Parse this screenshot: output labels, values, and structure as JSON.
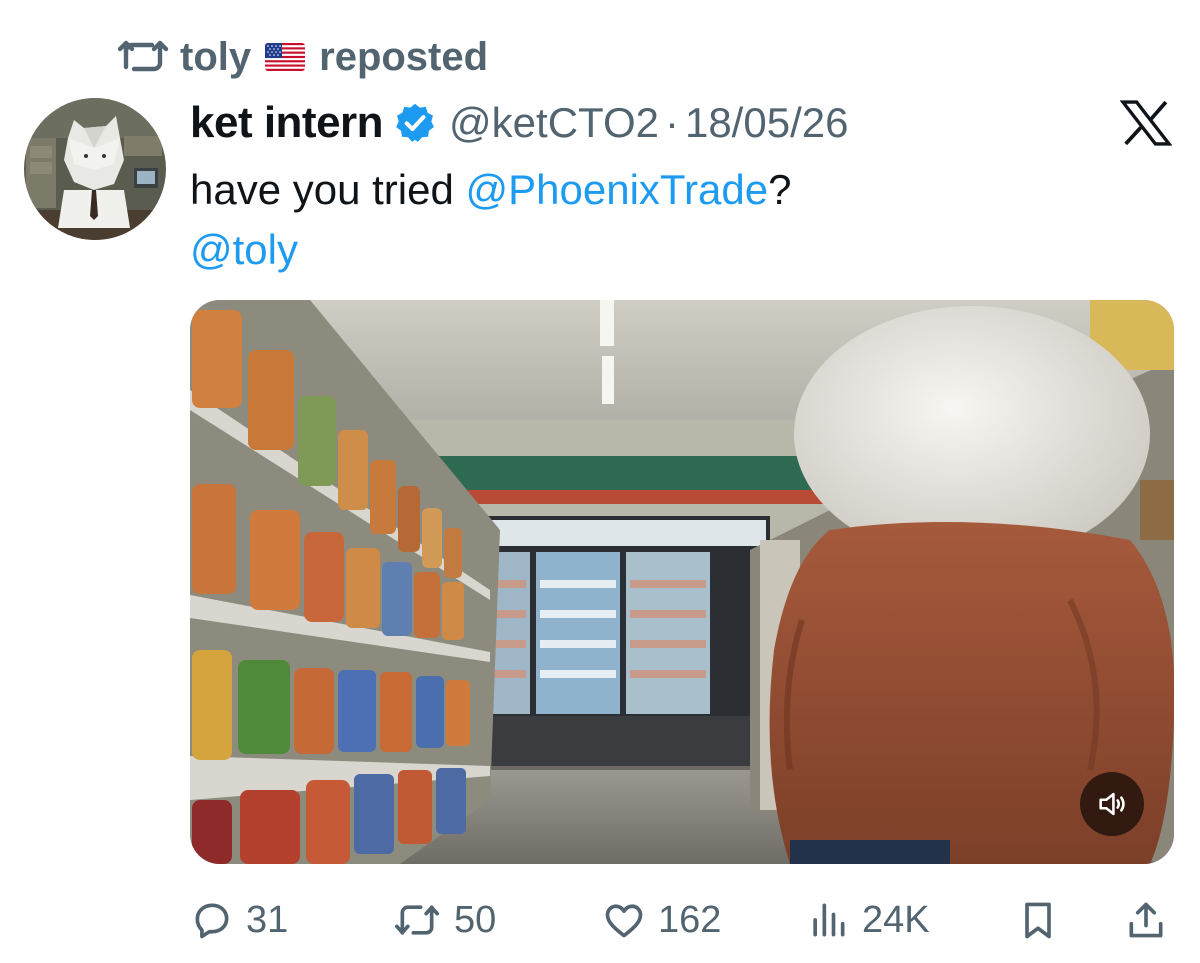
{
  "repost": {
    "icon": "repost-icon",
    "user": "toly",
    "flag": "us-flag",
    "label": "reposted"
  },
  "tweet": {
    "avatar": "avatar",
    "display_name": "ket intern",
    "verified_icon": "verified-badge-icon",
    "handle": "@ketCTO2",
    "separator": "·",
    "date": "18/05/26",
    "text_prefix": "have you tried ",
    "mention_1": "@PhoenixTrade",
    "text_suffix": "?",
    "mention_2": "@toly",
    "media_type": "video"
  },
  "actions": {
    "replies": "31",
    "reposts": "50",
    "likes": "162",
    "views": "24K"
  },
  "colors": {
    "text": "#0f1419",
    "secondary": "#536471",
    "link": "#1d9bf0",
    "verified": "#1d9bf0"
  }
}
